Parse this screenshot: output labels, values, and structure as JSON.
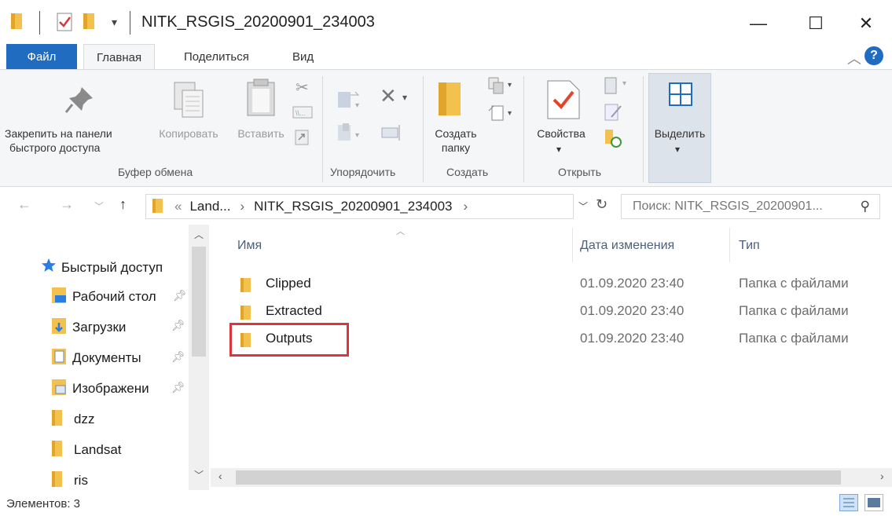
{
  "window": {
    "title": "NITK_RSGIS_20200901_234003",
    "minimize": "—",
    "maximize": "☐",
    "close": "✕"
  },
  "ribbon_tabs": {
    "file": "Файл",
    "home": "Главная",
    "share": "Поделиться",
    "view": "Вид"
  },
  "ribbon": {
    "pin_label_1": "Закрепить на панели",
    "pin_label_2": "быстрого доступа",
    "copy": "Копировать",
    "paste": "Вставить",
    "new_folder_1": "Создать",
    "new_folder_2": "папку",
    "properties": "Свойства",
    "select": "Выделить",
    "groups": {
      "clipboard": "Буфер обмена",
      "organize": "Упорядочить",
      "new": "Создать",
      "open": "Открыть"
    }
  },
  "address": {
    "overflow": "«",
    "crumb1": "Land...",
    "crumb2": "NITK_RSGIS_20200901_234003",
    "search_placeholder": "Поиск: NITK_RSGIS_20200901..."
  },
  "nav": {
    "quick_access": "Быстрый доступ",
    "items": [
      {
        "label": "Рабочий стол"
      },
      {
        "label": "Загрузки"
      },
      {
        "label": "Документы"
      },
      {
        "label": "Изображени"
      },
      {
        "label": "dzz"
      },
      {
        "label": "Landsat"
      },
      {
        "label": "ris"
      }
    ]
  },
  "columns": {
    "name": "Имя",
    "date": "Дата изменения",
    "type": "Тип"
  },
  "files": [
    {
      "name": "Clipped",
      "date": "01.09.2020 23:40",
      "type": "Папка с файлами"
    },
    {
      "name": "Extracted",
      "date": "01.09.2020 23:40",
      "type": "Папка с файлами"
    },
    {
      "name": "Outputs",
      "date": "01.09.2020 23:40",
      "type": "Папка с файлами"
    }
  ],
  "status": {
    "items_count": "Элементов: 3"
  },
  "colors": {
    "accent": "#1f6cc1",
    "highlight": "#d9363e",
    "folder": "#f2c14e"
  }
}
